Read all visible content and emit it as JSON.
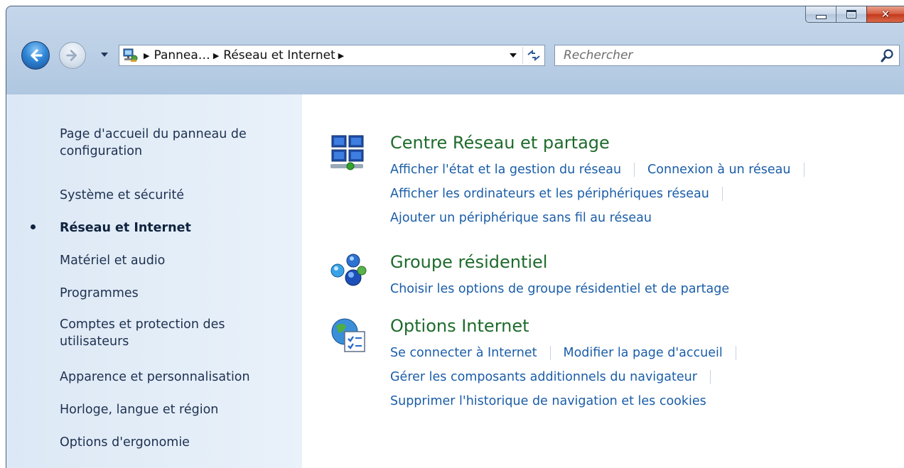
{
  "window": {
    "caption": {
      "minimize_glyph": "minimize",
      "maximize_glyph": "maximize",
      "close_glyph": "✕"
    }
  },
  "toolbar": {
    "breadcrumbs": [
      "Pannea…",
      "Réseau et Internet"
    ],
    "search_placeholder": "Rechercher"
  },
  "sidebar": {
    "items": [
      {
        "label": "Page d'accueil du panneau de configuration",
        "active": false
      },
      {
        "label": "Système et sécurité",
        "active": false
      },
      {
        "label": "Réseau et Internet",
        "active": true
      },
      {
        "label": "Matériel et audio",
        "active": false
      },
      {
        "label": "Programmes",
        "active": false
      },
      {
        "label": "Comptes et protection des utilisateurs",
        "active": false
      },
      {
        "label": "Apparence et personnalisation",
        "active": false
      },
      {
        "label": "Horloge, langue et région",
        "active": false
      },
      {
        "label": "Options d'ergonomie",
        "active": false
      }
    ]
  },
  "sections": [
    {
      "title": "Centre Réseau et partage",
      "icon": "network-center-icon",
      "links": [
        [
          "Afficher l'état et la gestion du réseau",
          "Connexion à un réseau"
        ],
        [
          "Afficher les ordinateurs et les périphériques réseau"
        ],
        [
          "Ajouter un périphérique sans fil au réseau"
        ]
      ]
    },
    {
      "title": "Groupe résidentiel",
      "icon": "homegroup-icon",
      "links": [
        [
          "Choisir les options de groupe résidentiel et de partage"
        ]
      ]
    },
    {
      "title": "Options Internet",
      "icon": "internet-options-icon",
      "links": [
        [
          "Se connecter à Internet",
          "Modifier la page d'accueil"
        ],
        [
          "Gérer les composants additionnels du navigateur"
        ],
        [
          "Supprimer l'historique de navigation et les cookies"
        ]
      ]
    }
  ],
  "colors": {
    "title_green": "#1e6b2c",
    "link_blue": "#1a5da8",
    "sidebar_text": "#1e3050"
  }
}
